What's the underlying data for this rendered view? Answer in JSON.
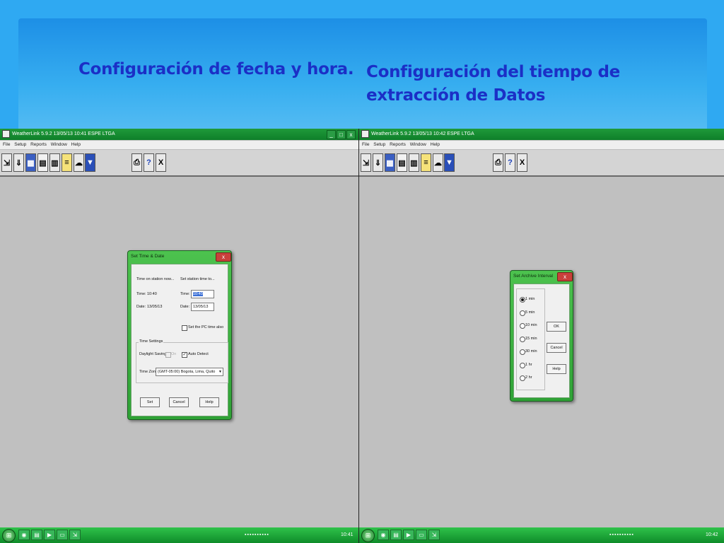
{
  "slide": {
    "title_left": "Configuración de fecha y hora.",
    "title_right": "Configuración del tiempo de extracción de Datos"
  },
  "window": {
    "title_left": "WeatherLink 5.9.2  13/05/13  10:41  ESPE LTGA",
    "title_right": "WeatherLink 5.9.2  13/05/13  10:42  ESPE LTGA",
    "menu": [
      "File",
      "Setup",
      "Reports",
      "Window",
      "Help"
    ],
    "toolbar_icons": [
      "connect-icon",
      "download-icon",
      "station-icon",
      "bulletin-icon",
      "summary-icon",
      "notes-icon",
      "weather-icon",
      "noaa-icon"
    ],
    "print_icon": "printer-icon",
    "help_label": "?",
    "exit_label": "X"
  },
  "set_time_dialog": {
    "title": "Set Time & Date",
    "close": "x",
    "station_now_label": "Time on station now...",
    "set_station_label": "Set station time to...",
    "time_label": "Time:",
    "time_value": "10:40",
    "date_label": "Date:",
    "date_value": "13/05/13",
    "set_time_label": "Time:",
    "set_time_value": "10:40",
    "set_date_label": "Date:",
    "set_date_value": "13/05/13",
    "pc_time_label": "Set the PC time also",
    "time_settings_label": "Time Settings",
    "daylight_label": "Daylight Savings:",
    "daylight_on_label": "On",
    "auto_detect_label": "Auto Detect",
    "timezone_label": "Time Zone:",
    "timezone_value": "(GMT-05:00) Bogota, Lima, Quito",
    "set_button": "Set",
    "cancel_button": "Cancel",
    "help_button": "Help"
  },
  "archive_dialog": {
    "title": "Set Archive Interval",
    "close": "x",
    "options": [
      "1 min",
      "5 min",
      "10 min",
      "15 min",
      "30 min",
      "1 hr",
      "2 hr"
    ],
    "selected_index": 0,
    "ok_button": "OK",
    "cancel_button": "Cancel",
    "help_button": "Help"
  },
  "taskbar": {
    "start": "⊞",
    "clock_left": "10:41",
    "clock_right": "10:42"
  },
  "colors": {
    "slide_background": "#2fa9f2",
    "title_text": "#1b2fc6",
    "window_chrome": "#1f9a3a",
    "workspace": "#c0c0c0"
  }
}
